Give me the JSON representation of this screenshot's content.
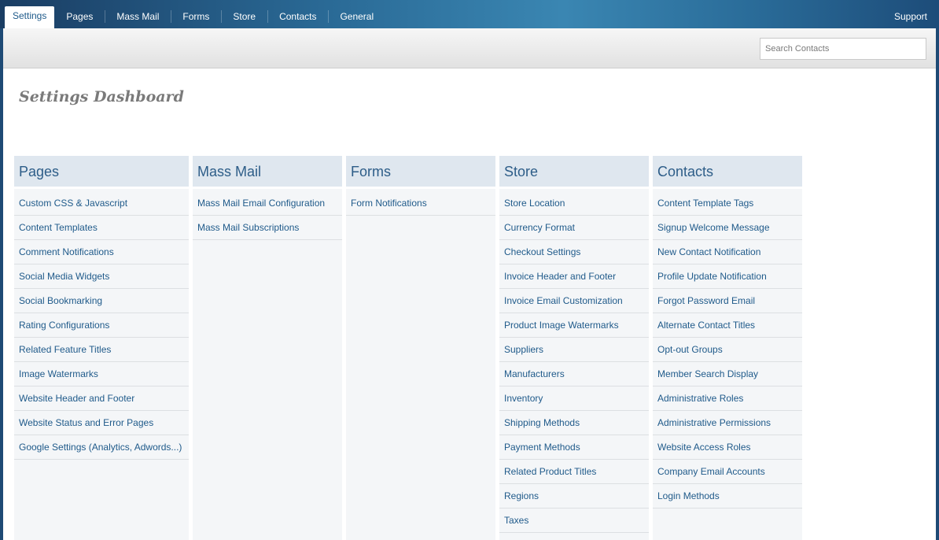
{
  "nav": {
    "tabs": [
      {
        "label": "Settings",
        "active": true
      },
      {
        "label": "Pages"
      },
      {
        "label": "Mass Mail"
      },
      {
        "label": "Forms"
      },
      {
        "label": "Store"
      },
      {
        "label": "Contacts"
      },
      {
        "label": "General"
      }
    ],
    "support": "Support"
  },
  "search": {
    "placeholder": "Search Contacts"
  },
  "page": {
    "title": "Settings Dashboard"
  },
  "colors": {
    "accent": "#1f5a8a",
    "panel_header": "#dfe7ef",
    "topbar": "#2a6a96"
  },
  "panels": [
    {
      "title": "Pages",
      "items": [
        "Custom CSS & Javascript",
        "Content Templates",
        "Comment Notifications",
        "Social Media Widgets",
        "Social Bookmarking",
        "Rating Configurations",
        "Related Feature Titles",
        "Image Watermarks",
        "Website Header and Footer",
        "Website Status and Error Pages",
        "Google Settings (Analytics, Adwords...)"
      ]
    },
    {
      "title": "Mass Mail",
      "items": [
        "Mass Mail Email Configuration",
        "Mass Mail Subscriptions"
      ]
    },
    {
      "title": "Forms",
      "items": [
        "Form Notifications"
      ]
    },
    {
      "title": "Store",
      "items": [
        "Store Location",
        "Currency Format",
        "Checkout Settings",
        "Invoice Header and Footer",
        "Invoice Email Customization",
        "Product Image Watermarks",
        "Suppliers",
        "Manufacturers",
        "Inventory",
        "Shipping Methods",
        "Payment Methods",
        "Related Product Titles",
        "Regions",
        "Taxes"
      ]
    },
    {
      "title": "Contacts",
      "items": [
        "Content Template Tags",
        "Signup Welcome Message",
        "New Contact Notification",
        "Profile Update Notification",
        "Forgot Password Email",
        "Alternate Contact Titles",
        "Opt-out Groups",
        "Member Search Display",
        "Administrative Roles",
        "Administrative Permissions",
        "Website Access Roles",
        "Company Email Accounts",
        "Login Methods"
      ]
    }
  ]
}
